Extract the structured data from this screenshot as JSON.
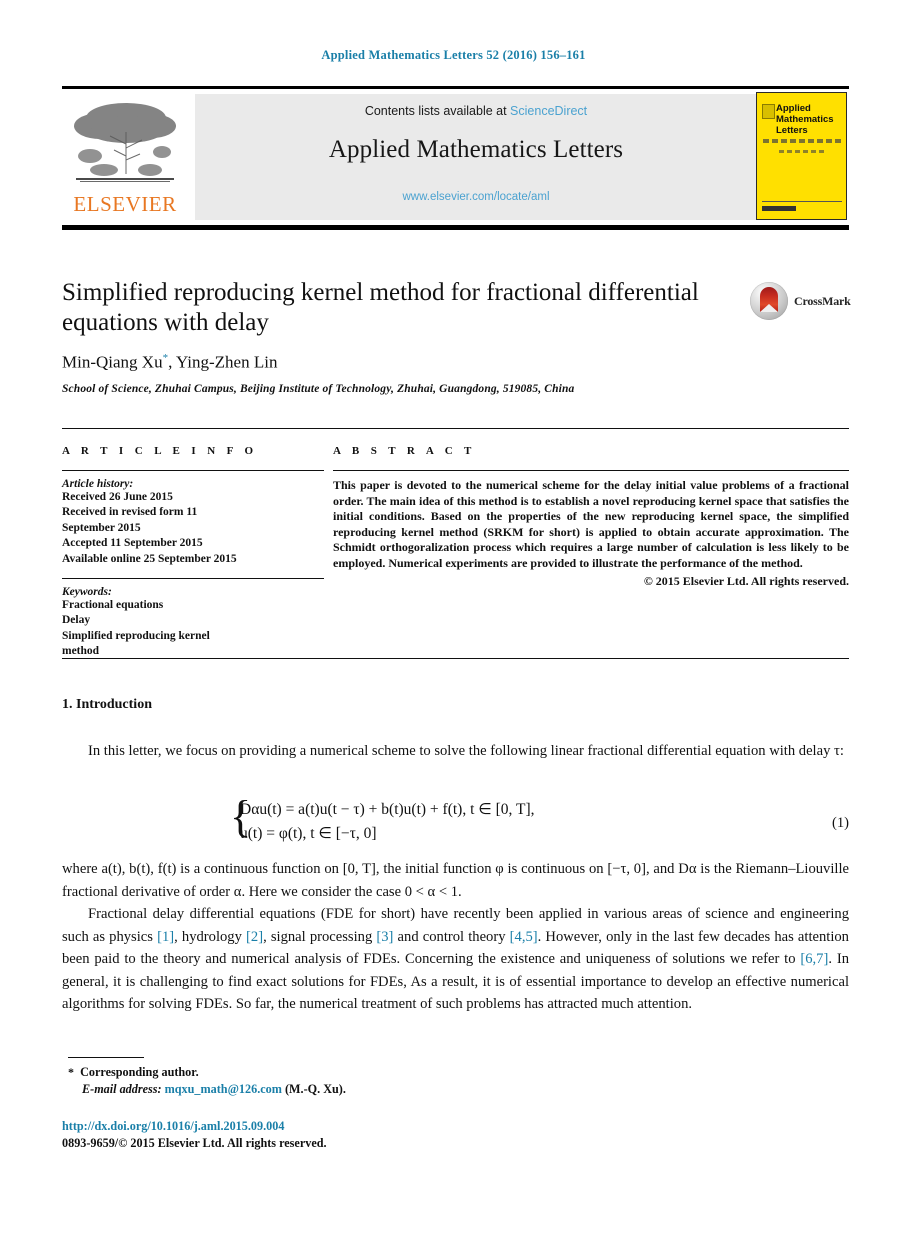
{
  "running_head": "Applied Mathematics Letters 52 (2016) 156–161",
  "masthead": {
    "contents_prefix": "Contents lists available at ",
    "sciencedirect_link": "ScienceDirect",
    "journal_title": "Applied Mathematics Letters",
    "journal_url": "www.elsevier.com/locate/aml",
    "publisher_logo_text": "ELSEVIER",
    "cover": {
      "line1": "Applied",
      "line2": "Mathematics",
      "line3": "Letters"
    }
  },
  "article": {
    "title": "Simplified reproducing kernel method for fractional differential equations with delay",
    "authors": "Min-Qiang Xu",
    "author_marker": "*",
    "authors_rest": ", Ying-Zhen Lin",
    "affiliation": "School of Science, Zhuhai Campus, Beijing Institute of Technology, Zhuhai, Guangdong, 519085, China",
    "crossmark_label": "CrossMark"
  },
  "info": {
    "heading": "A R T I C L E   I N F O",
    "history_label": "Article history:",
    "history": [
      "Received 26 June 2015",
      "Received in revised form 11",
      "September 2015",
      "Accepted 11 September 2015",
      "Available online 25 September 2015"
    ],
    "keywords_label": "Keywords:",
    "keywords": [
      "Fractional equations",
      "Delay",
      "Simplified reproducing kernel",
      "method"
    ]
  },
  "abstract": {
    "heading": "A B S T R A C T",
    "text": "This paper is devoted to the numerical scheme for the delay initial value problems of a fractional order. The main idea of this method is to establish a novel reproducing kernel space that satisfies the initial conditions. Based on the properties of the new reproducing kernel space, the simplified reproducing kernel method (SRKM for short) is applied to obtain accurate approximation. The Schmidt orthogoralization process which requires a large number of calculation is less likely to be employed. Numerical experiments are provided to illustrate the performance of the method.",
    "copyright": "© 2015 Elsevier Ltd. All rights reserved."
  },
  "body": {
    "section_heading": "1. Introduction",
    "para1": "In this letter, we focus on providing a numerical scheme to solve the following linear fractional differential equation with delay τ:",
    "equation": {
      "line1": "Dαu(t) = a(t)u(t − τ) + b(t)u(t) + f(t),    t ∈ [0, T],",
      "line2": "u(t) = φ(t),    t ∈ [−τ, 0]",
      "number": "(1)"
    },
    "para2_a": "where a(t), b(t), f(t) is a continuous function on [0, T], the initial function φ is continuous on [−τ, 0], and Dα is the Riemann–Liouville fractional derivative of order α. Here we consider the case 0 < α < 1.",
    "para3_pre": "Fractional delay differential equations (FDE for short) have recently been applied in various areas of science and engineering such as physics ",
    "ref1": "[1]",
    "para3_b": ", hydrology ",
    "ref2": "[2]",
    "para3_c": ", signal processing ",
    "ref3": "[3]",
    "para3_d": " and control theory ",
    "ref45": "[4,5]",
    "para3_e": ". However, only in the last few decades has attention been paid to the theory and numerical analysis of FDEs. Concerning the existence and uniqueness of solutions we refer to ",
    "ref67": "[6,7]",
    "para3_f": ". In general, it is challenging to find exact solutions for FDEs, As a result, it is of essential importance to develop an effective numerical algorithms for solving FDEs. So far, the numerical treatment of such problems has attracted much attention."
  },
  "footnotes": {
    "corresponding": "Corresponding author.",
    "email_label": "E-mail address:",
    "email": "mqxu_math@126.com",
    "email_owner": "(M.-Q. Xu).",
    "doi": "http://dx.doi.org/10.1016/j.aml.2015.09.004",
    "issn": "0893-9659/© 2015 Elsevier Ltd. All rights reserved."
  },
  "colors": {
    "link_blue": "#1a7fa8",
    "light_blue": "#4ba2d0",
    "elsevier_orange": "#E87722",
    "cover_yellow": "#FFE000"
  }
}
